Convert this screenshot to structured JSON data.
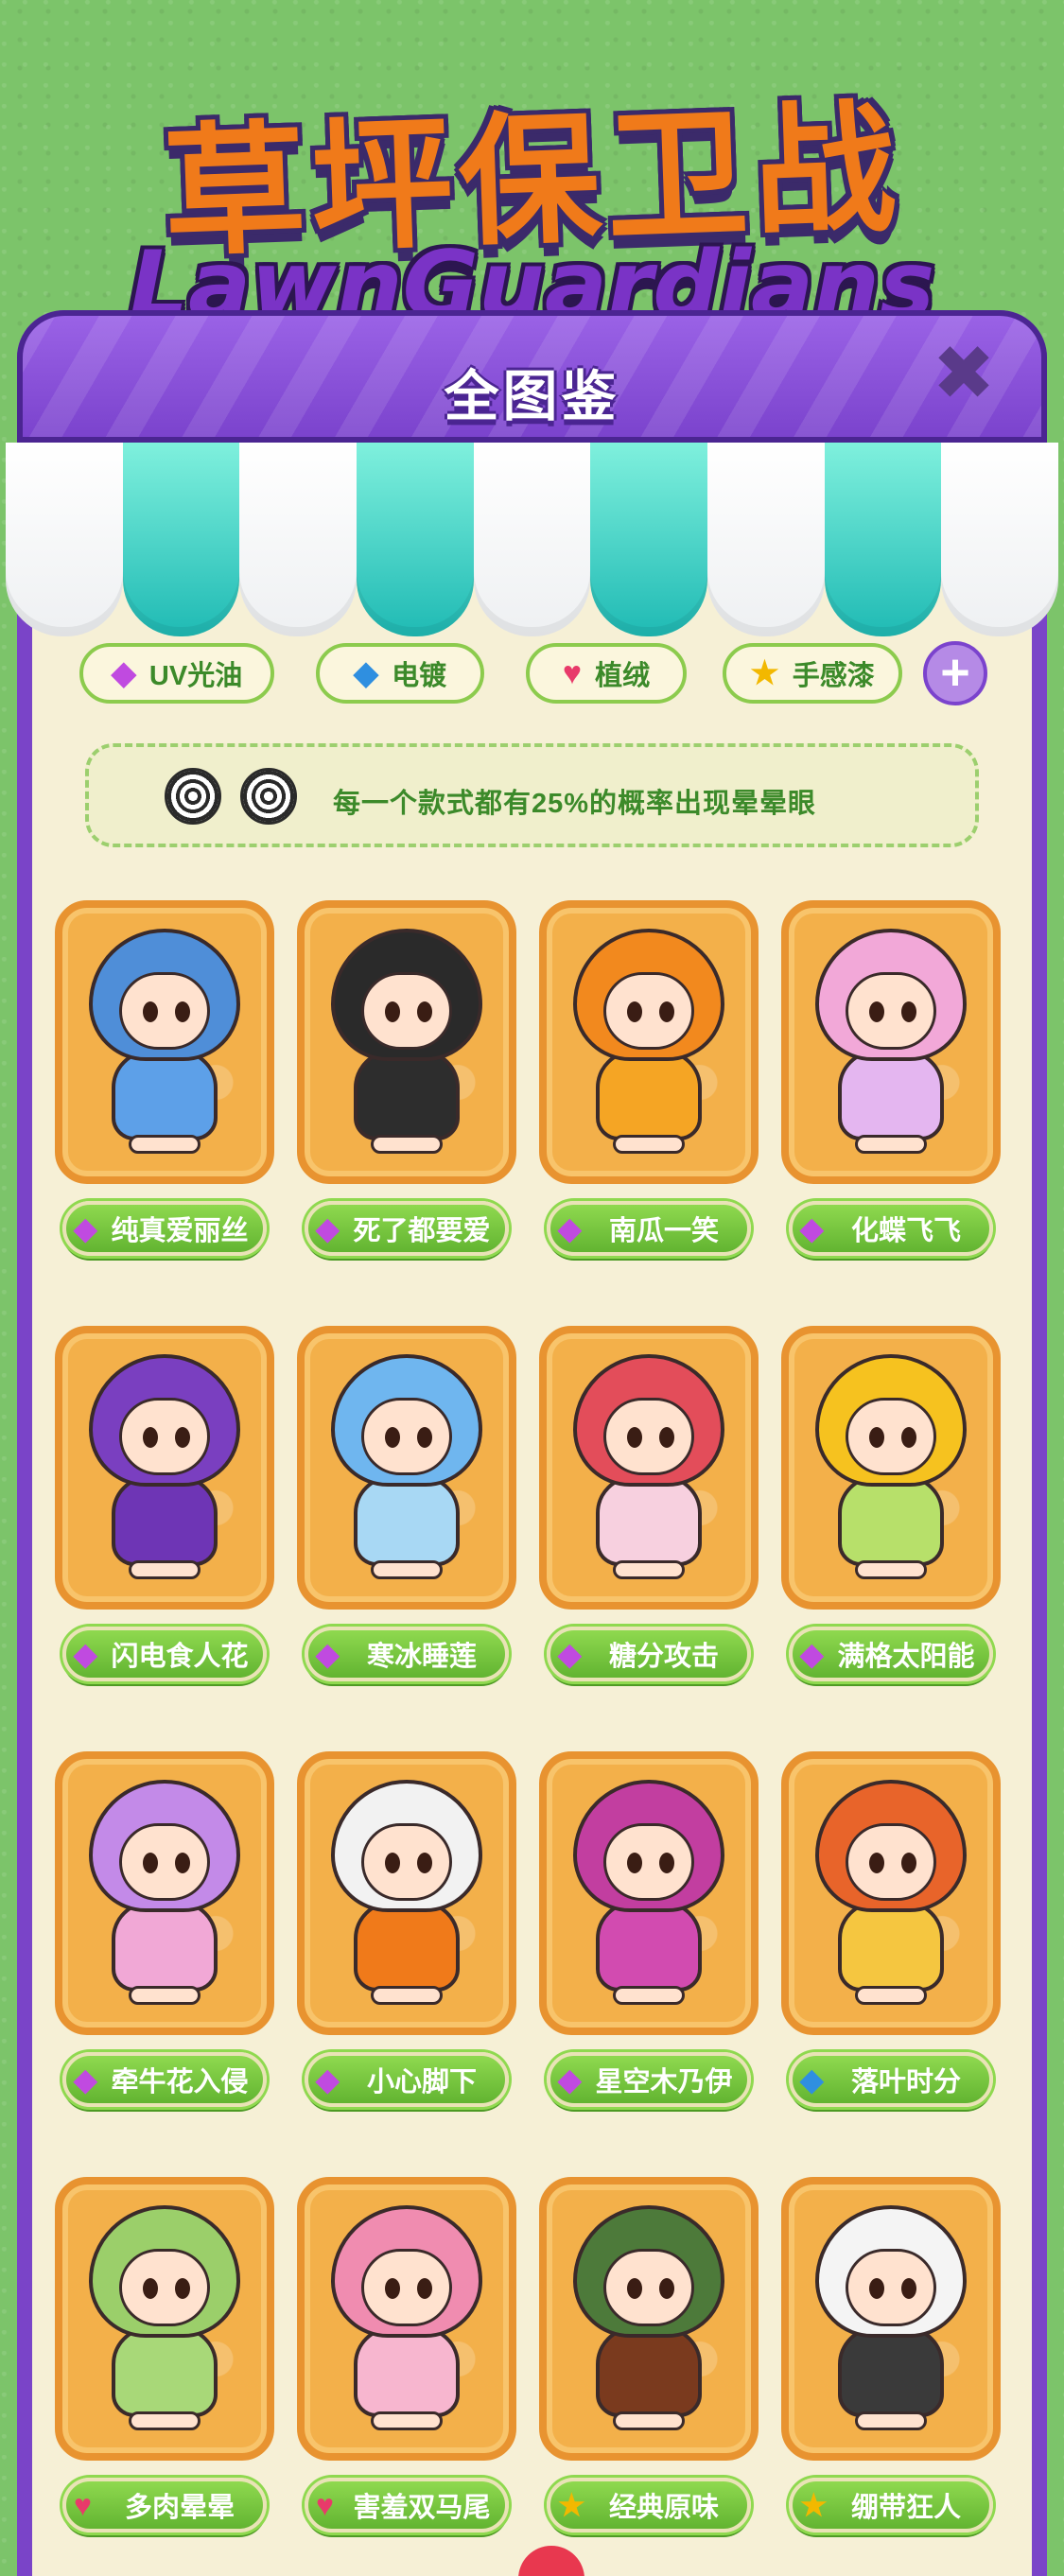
{
  "title": {
    "cn": "草坪保卫战",
    "en": "LawnGuardians"
  },
  "panel": {
    "title": "全图鉴",
    "close_icon": "close-x-icon"
  },
  "colors": {
    "panel_border": "#7a44c8",
    "label_green": "#6cc03a",
    "card_orange": "#f3b04a",
    "tag_text": "#3c8a2a"
  },
  "tags": [
    {
      "label": "UV光油",
      "icon": "purple-gem-icon"
    },
    {
      "label": "电镀",
      "icon": "blue-diamond-icon"
    },
    {
      "label": "植绒",
      "icon": "red-heart-icon"
    },
    {
      "label": "手感漆",
      "icon": "gold-star-icon"
    }
  ],
  "notice": {
    "text": "每一个款式都有25%的概率出现晕晕眼"
  },
  "cards": [
    {
      "label": "纯真爱丽丝",
      "icon": "purple-gem-icon",
      "hood": "#4f8ed8",
      "body": "#5da0e8"
    },
    {
      "label": "死了都要爱",
      "icon": "purple-gem-icon",
      "hood": "#2a2a2a",
      "body": "#2d2d2d"
    },
    {
      "label": "南瓜一笑",
      "icon": "purple-gem-icon",
      "hood": "#f2891e",
      "body": "#f5a524"
    },
    {
      "label": "化蝶飞飞",
      "icon": "purple-gem-icon",
      "hood": "#f2a8d8",
      "body": "#e4b6f0"
    },
    {
      "label": "闪电食人花",
      "icon": "purple-gem-icon",
      "hood": "#7a3fc0",
      "body": "#6e35b5"
    },
    {
      "label": "寒冰睡莲",
      "icon": "purple-gem-icon",
      "hood": "#6fb6ef",
      "body": "#a8d8f4"
    },
    {
      "label": "糖分攻击",
      "icon": "purple-gem-icon",
      "hood": "#e34d5a",
      "body": "#f7d0df"
    },
    {
      "label": "满格太阳能",
      "icon": "purple-gem-icon",
      "hood": "#f6c21f",
      "body": "#b7e06a"
    },
    {
      "label": "牵牛花入侵",
      "icon": "purple-gem-icon",
      "hood": "#c38ae8",
      "body": "#f1a8d6"
    },
    {
      "label": "小心脚下",
      "icon": "purple-gem-icon",
      "hood": "#f2f2f2",
      "body": "#f07a1a"
    },
    {
      "label": "星空木乃伊",
      "icon": "purple-gem-icon",
      "hood": "#c23ea0",
      "body": "#d24bb0"
    },
    {
      "label": "落叶时分",
      "icon": "blue-diamond-icon",
      "hood": "#e8642a",
      "body": "#f5c640"
    },
    {
      "label": "多肉晕晕",
      "icon": "red-heart-icon",
      "hood": "#9bcf6a",
      "body": "#a8d878"
    },
    {
      "label": "害羞双马尾",
      "icon": "red-heart-icon",
      "hood": "#f08cb0",
      "body": "#f7b6cf"
    },
    {
      "label": "经典原味",
      "icon": "gold-star-icon",
      "hood": "#4d7a3a",
      "body": "#7a3a1e"
    },
    {
      "label": "绷带狂人",
      "icon": "gold-star-icon",
      "hood": "#f4f4f4",
      "body": "#3a3a3a"
    }
  ]
}
